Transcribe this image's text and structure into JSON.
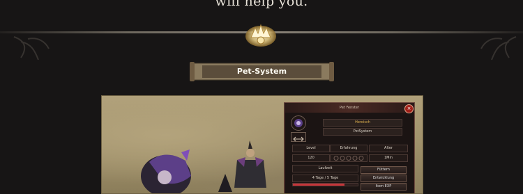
{
  "page": {
    "top_text": "will help you.",
    "section_title": "Pet-System"
  },
  "colors": {
    "background": "#171515",
    "accent_gold": "#d6b25a",
    "bar_red": "#c7353a"
  },
  "pet_window": {
    "title": "Pet Fenster",
    "close_label": "×",
    "rank": "Heroisch",
    "name": "PetSystem",
    "stats_headers": [
      "Level",
      "Erfahrung",
      "Alter"
    ],
    "stats_values": [
      "120",
      "",
      "1Min"
    ],
    "laufzeit_label": "Laufzeit",
    "laufzeit_value": "4 Tage  / 5 Tage",
    "laufzeit_fraction": 0.8,
    "buttons": [
      "Füttern",
      "Entwicklung",
      "Item EXP"
    ]
  }
}
